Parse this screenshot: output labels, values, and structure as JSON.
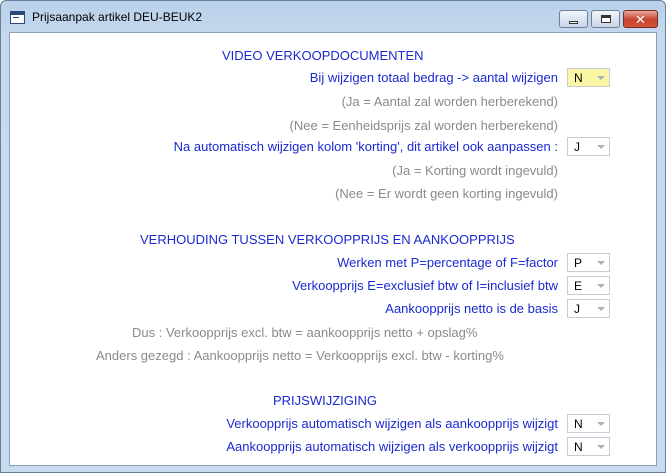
{
  "window": {
    "title": "Prijsaanpak artikel DEU-BEUK2",
    "close_glyph": "✕"
  },
  "sections": {
    "video": {
      "heading": "VIDEO VERKOOPDOCUMENTEN",
      "q1_label": "Bij wijzigen totaal bedrag -> aantal wijzigen",
      "q1_value": "N",
      "q1_note1": "(Ja  = Aantal zal worden herberekend)",
      "q1_note2": "(Nee = Eenheidsprijs zal worden herberekend)",
      "q2_label": "Na automatisch wijzigen kolom 'korting', dit artikel ook aanpassen :",
      "q2_value": "J",
      "q2_note1": "(Ja  = Korting wordt ingevuld)",
      "q2_note2": "(Nee = Er wordt geen korting ingevuld)"
    },
    "verhouding": {
      "heading": "VERHOUDING TUSSEN VERKOOPPRIJS EN AANKOOPPRIJS",
      "q1_label": "Werken met P=percentage of F=factor",
      "q1_value": "P",
      "q2_label": "Verkoopprijs E=exclusief btw of I=inclusief btw",
      "q2_value": "E",
      "q3_label": "Aankoopprijs netto is de basis",
      "q3_value": "J",
      "note1": "Dus : Verkoopprijs excl. btw = aankoopprijs netto + opslag%",
      "note2": "Anders gezegd : Aankoopprijs netto = Verkoopprijs excl. btw - korting%"
    },
    "prijswijziging": {
      "heading": "PRIJSWIJZIGING",
      "q1_label": "Verkoopprijs automatisch wijzigen als aankoopprijs wijzigt",
      "q1_value": "N",
      "q2_label": "Aankoopprijs automatisch wijzigen als verkoopprijs wijzigt",
      "q2_value": "N"
    }
  },
  "colors": {
    "label_blue": "#1a2ad1",
    "note_gray": "#8a8a8a",
    "highlight_yellow": "#fbf7a6"
  }
}
